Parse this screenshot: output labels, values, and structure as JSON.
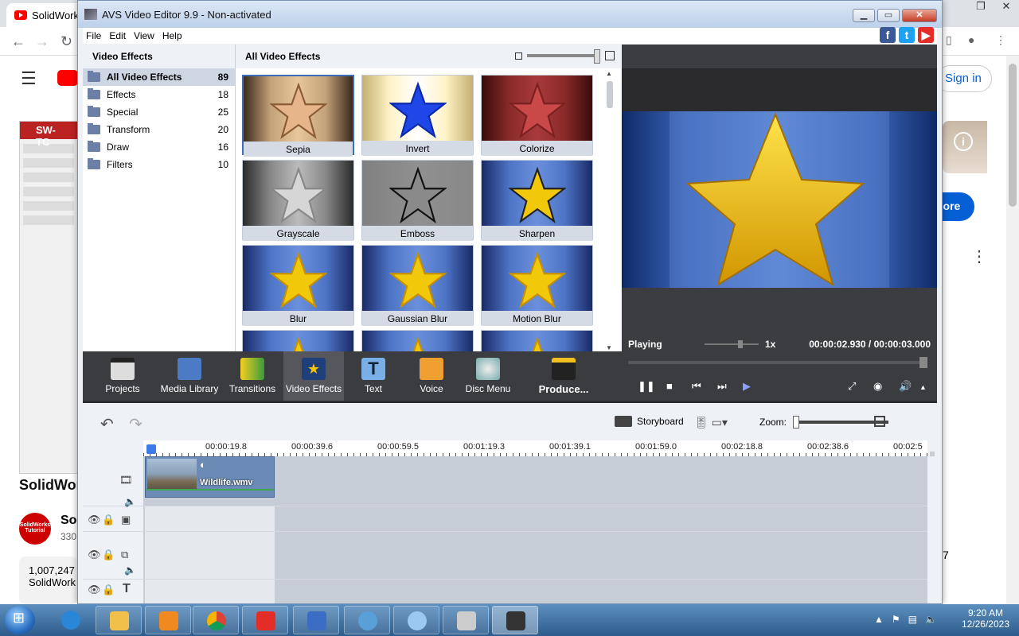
{
  "browser": {
    "tab_title": "SolidWork",
    "sign_in": "Sign in",
    "more": "nore",
    "sw_thumb_title": "SW-TC",
    "sw_caption": "SolidWor",
    "sw_channel": "So",
    "sw_subs": "330",
    "sw_views": "1,007,247",
    "sw_views_sub": "SolidWork",
    "right_num": "7",
    "avatar_text": "SolidWorks Tutorial"
  },
  "window": {
    "title": "AVS Video Editor 9.9 - Non-activated",
    "menu": [
      "File",
      "Edit",
      "View",
      "Help"
    ],
    "social": [
      {
        "icon": "facebook-icon",
        "glyph": "f",
        "color": "#3b5998"
      },
      {
        "icon": "twitter-icon",
        "glyph": "t",
        "color": "#1da1f2"
      },
      {
        "icon": "youtube-icon",
        "glyph": "▶",
        "color": "#e52d27"
      }
    ]
  },
  "categories": {
    "header": "Video Effects",
    "items": [
      {
        "name": "All Video Effects",
        "count": "89",
        "selected": true
      },
      {
        "name": "Effects",
        "count": "18"
      },
      {
        "name": "Special",
        "count": "25"
      },
      {
        "name": "Transform",
        "count": "20"
      },
      {
        "name": "Draw",
        "count": "16"
      },
      {
        "name": "Filters",
        "count": "10"
      }
    ]
  },
  "effects": {
    "header": "All Video Effects",
    "tiles": [
      "Sepia",
      "Invert",
      "Colorize",
      "Grayscale",
      "Emboss",
      "Sharpen",
      "Blur",
      "Gaussian Blur",
      "Motion Blur",
      "",
      "",
      ""
    ]
  },
  "preview": {
    "status": "Playing",
    "speed": "1x",
    "time": "00:00:02.930  /  00:00:03.000"
  },
  "toolbar": {
    "items": [
      "Projects",
      "Media Library",
      "Transitions",
      "Video Effects",
      "Text",
      "Voice",
      "Disc Menu",
      "Produce..."
    ]
  },
  "timeline": {
    "storyboard": "Storyboard",
    "zoom_label": "Zoom:",
    "ticks": [
      "00:00:19.8",
      "00:00:39.6",
      "00:00:59.5",
      "00:01:19.3",
      "00:01:39.1",
      "00:01:59.0",
      "00:02:18.8",
      "00:02:38.6",
      "00:02:5"
    ],
    "clip_name": "Wildlife.wmv"
  },
  "taskbar": {
    "time": "9:20 AM",
    "date": "12/26/2023"
  }
}
